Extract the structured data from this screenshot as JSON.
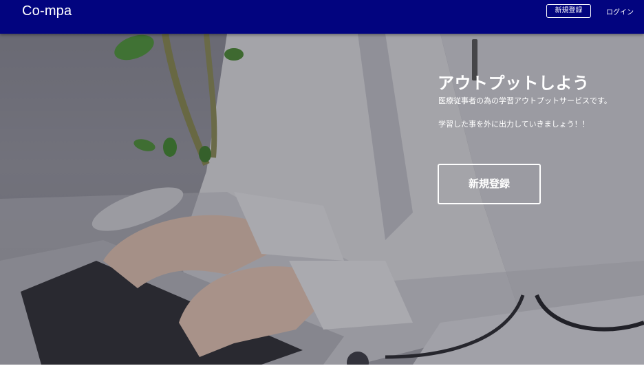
{
  "navbar": {
    "brand": "Co-mpa",
    "signup_label": "新規登録",
    "login_label": "ログイン",
    "background_color": "#02047f"
  },
  "hero": {
    "title": "アウトプットしよう",
    "description_line1": "医療従事者の為の学習アウトプットサービスです。",
    "description_line2": "学習した事を外に出力していきましょう！！",
    "signup_label": "新規登録",
    "image_description_icon": "doctor-typing-laptop-photo"
  }
}
